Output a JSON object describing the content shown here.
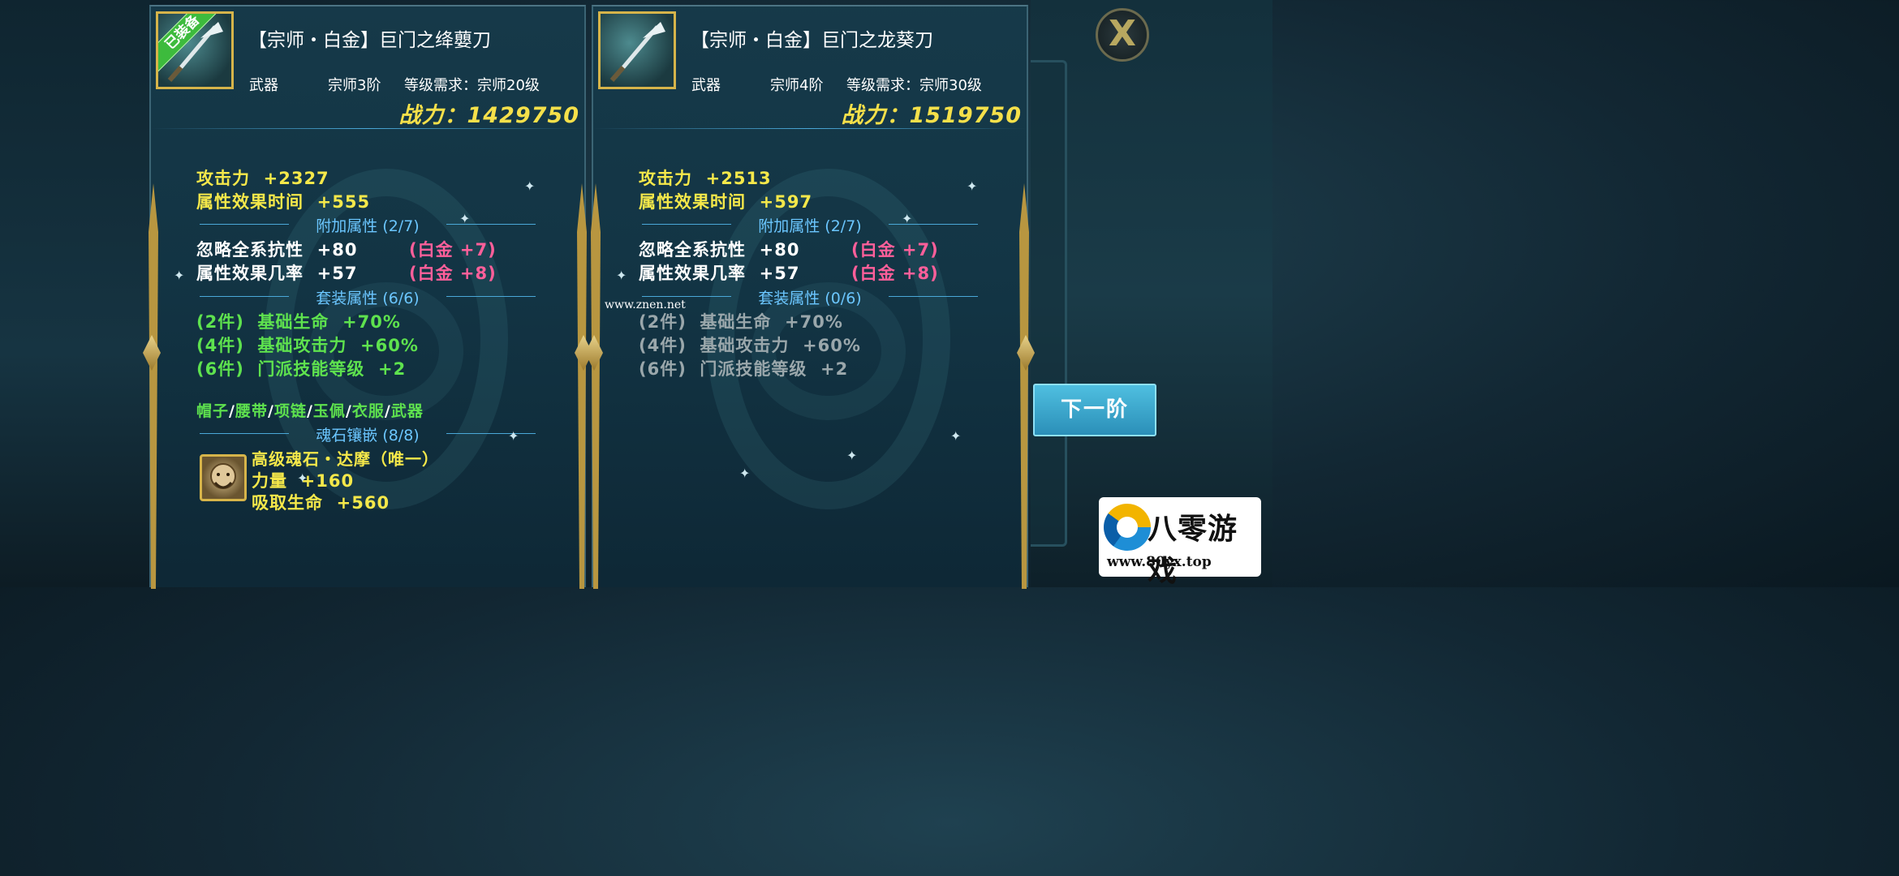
{
  "close_button": {
    "label": "X"
  },
  "left_panel": {
    "equipped_badge": "已装备",
    "title": "【宗师・白金】巨门之绛蘡刀",
    "type": "武器",
    "rank": "宗师3阶",
    "level_req": "等级需求：宗师20级",
    "power": "战力：1429750",
    "base_stats": [
      {
        "text": "攻击力  +2327"
      },
      {
        "text": "属性效果时间  +555"
      }
    ],
    "extra_header": "附加属性 (2/7)",
    "extra_stats": [
      {
        "text": "忽略全系抗性  +80",
        "tag": "(白金 +7)"
      },
      {
        "text": "属性效果几率  +57",
        "tag": "(白金 +8)"
      }
    ],
    "set_header": "套装属性 (6/6)",
    "set_bonuses": [
      "(2件)  基础生命  +70%",
      "(4件)  基础攻击力  +60%",
      "(6件)  门派技能等级  +2"
    ],
    "set_parts": [
      "帽子",
      "腰带",
      "项链",
      "玉佩",
      "衣服",
      "武器"
    ],
    "set_sep": "/",
    "soul_header": "魂石镶嵌 (8/8)",
    "soul_stone": {
      "name": "高级魂石・达摩（唯一）",
      "stat1": "力量  +160",
      "stat2": "吸取生命  +560"
    }
  },
  "right_panel": {
    "title": "【宗师・白金】巨门之龙葵刀",
    "type": "武器",
    "rank": "宗师4阶",
    "level_req": "等级需求：宗师30级",
    "power": "战力：1519750",
    "base_stats": [
      {
        "text": "攻击力  +2513"
      },
      {
        "text": "属性效果时间  +597"
      }
    ],
    "extra_header": "附加属性 (2/7)",
    "extra_stats": [
      {
        "text": "忽略全系抗性  +80",
        "tag": "(白金 +7)"
      },
      {
        "text": "属性效果几率  +57",
        "tag": "(白金 +8)"
      }
    ],
    "set_header": "套装属性 (0/6)",
    "set_bonuses": [
      "(2件)  基础生命  +70%",
      "(4件)  基础攻击力  +60%",
      "(6件)  门派技能等级  +2"
    ]
  },
  "next_button": {
    "label": "下一阶"
  },
  "watermark": "www.znen.net",
  "logo": {
    "text": "八零游戏",
    "url": "www.80yx.top"
  },
  "colors": {
    "stat_yellow": "#f5e84a",
    "power_gold": "#f5e04a",
    "platinum_pink": "#ff5f9a",
    "set_active_green": "#5ee24e",
    "set_inactive_gray": "#9aa7ab",
    "section_blue": "#6bc6ff",
    "button_blue": "#3aa6cc"
  }
}
